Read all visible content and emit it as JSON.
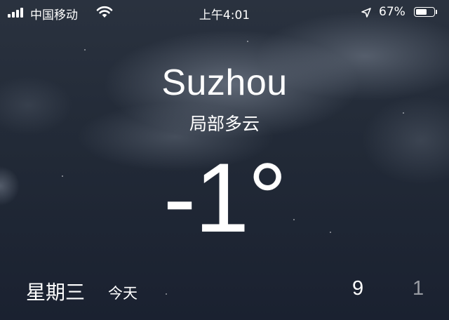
{
  "status_bar": {
    "carrier": "中国移动",
    "time": "上午4:01",
    "battery_percent": "67%",
    "battery_level": 0.67,
    "icons": [
      "signal-bars-icon",
      "wifi-icon",
      "location-arrow-icon",
      "battery-icon"
    ]
  },
  "weather": {
    "city": "Suzhou",
    "condition": "局部多云",
    "temperature": "-1°"
  },
  "forecast_today": {
    "weekday": "星期三",
    "today_label": "今天",
    "high": "9",
    "low": "1"
  }
}
